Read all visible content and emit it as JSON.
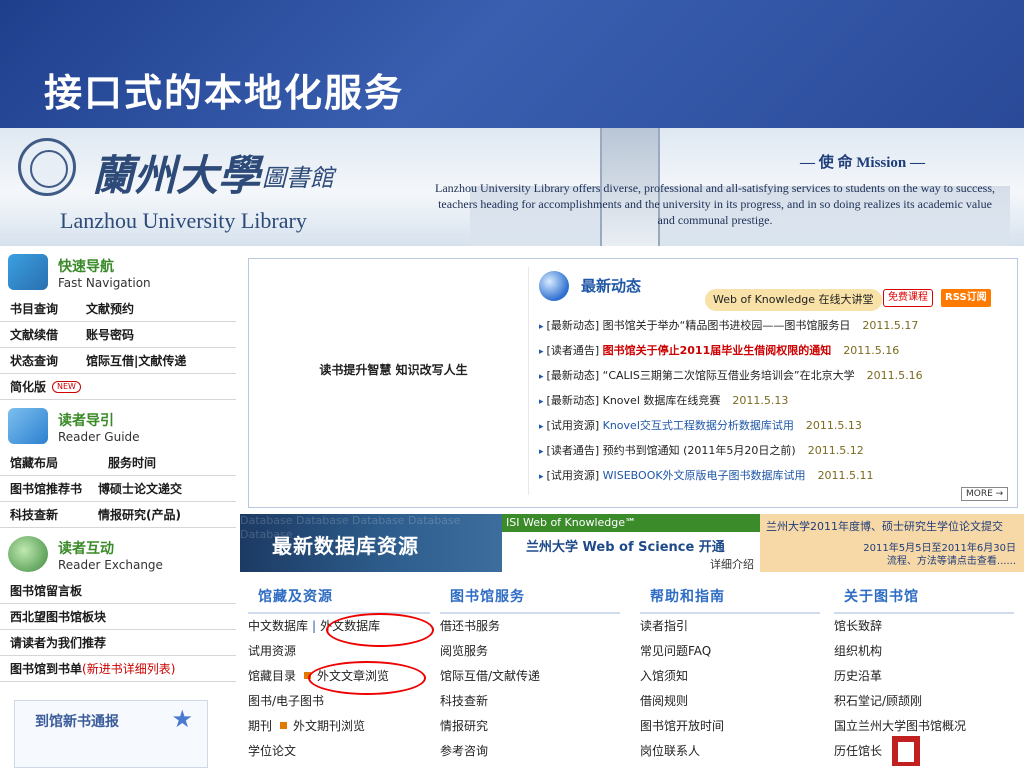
{
  "slide": {
    "title": "接口式的本地化服务"
  },
  "banner": {
    "logo_text": "蘭州大學",
    "logo_sub": "圖書館",
    "english_name": "Lanzhou University Library",
    "mission": "— 使 命 Mission —",
    "slogan": "Lanzhou University Library offers diverse, professional and all-satisfying services to students on the way to success, teachers heading for accomplishments and the university in its progress, and in so doing realizes its academic value and communal prestige."
  },
  "sidebar": {
    "fast_nav": {
      "title": "快速导航",
      "subtitle": "Fast Navigation"
    },
    "fast_rows": [
      [
        "书目查询",
        "文献预约"
      ],
      [
        "文献续借",
        "账号密码"
      ],
      [
        "状态查询",
        "馆际互借|文献传递"
      ]
    ],
    "simple_version": "简化版",
    "new_badge": "NEW",
    "reader_guide": {
      "title": "读者导引",
      "subtitle": "Reader Guide"
    },
    "guide_rows": [
      [
        "馆藏布局",
        "服务时间"
      ],
      [
        "图书馆推荐书",
        "博硕士论文递交"
      ],
      [
        "科技查新",
        "情报研究(产品)"
      ]
    ],
    "reader_exchange": {
      "title": "读者互动",
      "subtitle": "Reader Exchange"
    },
    "exchange_rows": [
      "图书馆留言板",
      "西北望图书馆板块",
      "请读者为我们推荐"
    ],
    "arrival_label": "图书馆到书单",
    "arrival_detail": "(新进书详细列表)",
    "new_books_title": "到馆新书通报"
  },
  "panel": {
    "photo_caption": "读书提升智慧  知识改写人生",
    "news_title": "最新动态",
    "wok_banner": "Web of Knowledge 在线大讲堂",
    "free_badge": "免费课程",
    "rss_badge": "RSS订阅",
    "news": [
      {
        "cat": "[最新动态]",
        "text": "图书馆关于举办“精品图书进校园——图书馆服务日",
        "date": "2011.5.17",
        "style": ""
      },
      {
        "cat": "[读者通告]",
        "text": "图书馆关于停止2011届毕业生借阅权限的通知",
        "date": "2011.5.16",
        "style": "red"
      },
      {
        "cat": "[最新动态]",
        "text": "“CALIS三期第二次馆际互借业务培训会”在北京大学",
        "date": "2011.5.16",
        "style": ""
      },
      {
        "cat": "[最新动态]",
        "text": "Knovel 数据库在线竞赛",
        "date": "2011.5.13",
        "style": ""
      },
      {
        "cat": "[试用资源]",
        "text": "Knovel交互式工程数据分析数据库试用",
        "date": "2011.5.13",
        "style": "blue"
      },
      {
        "cat": "[读者通告]",
        "text": "预约书到馆通知 (2011年5月20日之前)",
        "date": "2011.5.12",
        "style": ""
      },
      {
        "cat": "[试用资源]",
        "text": "WISEBOOK外文原版电子图书数据库试用",
        "date": "2011.5.11",
        "style": "blue"
      }
    ],
    "more_label": "MORE →"
  },
  "promos": {
    "db_title": "最新数据库资源",
    "db_ghost": "Database Database Database Database Database",
    "isi_header": "ISI Web of Knowledge℠",
    "isi_body": "兰州大学 Web of Science 开通",
    "isi_detail": "详细介绍",
    "thesis_header": "兰州大学2011年度博、硕士研究生学位论文提交",
    "thesis_detail": "2011年5月5日至2011年6月30日\n流程、方法等请点击查看......"
  },
  "columns": [
    {
      "title": "馆藏及资源",
      "items": [
        "中文数据库|外文数据库",
        "试用资源",
        "馆藏目录 ■ 外文文章浏览",
        "图书/电子图书",
        "期刊 ■ 外文期刊浏览",
        "学位论文"
      ]
    },
    {
      "title": "图书馆服务",
      "items": [
        "借还书服务",
        "阅览服务",
        "馆际互借/文献传递",
        "科技查新",
        "情报研究",
        "参考咨询"
      ]
    },
    {
      "title": "帮助和指南",
      "items": [
        "读者指引",
        "常见问题FAQ",
        "入馆须知",
        "借阅规则",
        "图书馆开放时间",
        "岗位联系人"
      ]
    },
    {
      "title": "关于图书馆",
      "items": [
        "馆长致辞",
        "组织机构",
        "历史沿革",
        "积石堂记/顾颉刚",
        "国立兰州大学图书馆概况",
        "历任馆长"
      ]
    }
  ],
  "col1_parts": {
    "cn_db": "中文数据库",
    "sep": "|",
    "en_db": "外文数据库",
    "trial": "试用资源",
    "catalog": "馆藏目录",
    "article_browse": "外文文章浏览",
    "books": "图书/电子图书",
    "journals": "期刊",
    "journal_browse": "外文期刊浏览",
    "thesis": "学位论文"
  }
}
